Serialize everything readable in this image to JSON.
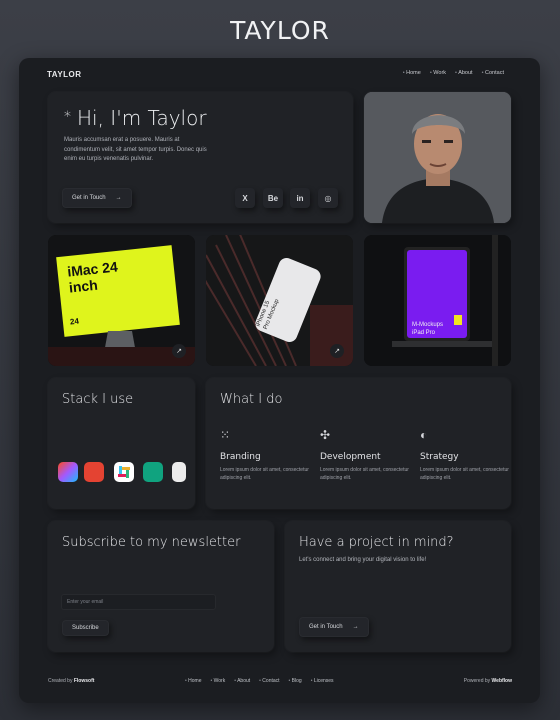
{
  "page_title": "TAYLOR",
  "header": {
    "logo": "TAYLOR",
    "nav": [
      "Home",
      "Work",
      "About",
      "Contact"
    ]
  },
  "hero": {
    "greeting": "Hi, I'm Taylor",
    "star": "*",
    "text": "Mauris accumsan erat a posuere. Mauris at condimentum velit, sit amet tempor turpis. Donec quis enim eu turpis venenatis pulvinar.",
    "cta": "Get in Touch",
    "socials": [
      "X",
      "Be",
      "in",
      "◎"
    ]
  },
  "works": [
    {
      "line1": "iMac 24",
      "line2": "inch",
      "small": "24"
    },
    {
      "line1": "iPhone 15",
      "line2": "Pro Mockup"
    },
    {
      "line1": "M-Mockups",
      "line2": "iPad Pro"
    }
  ],
  "stack": {
    "title": "Stack I use"
  },
  "what_i_do": {
    "title": "What I do",
    "items": [
      {
        "name": "Branding",
        "desc": "Lorem ipsum dolor sit amet, consectetur adipiscing elit."
      },
      {
        "name": "Development",
        "desc": "Lorem ipsum dolor sit amet, consectetur adipiscing elit."
      },
      {
        "name": "Strategy",
        "desc": "Lorem ipsum dolor sit amet, consectetur adipiscing elit."
      }
    ]
  },
  "newsletter": {
    "title": "Subscribe to my newsletter",
    "placeholder": "Enter your email",
    "button": "Subscribe"
  },
  "project": {
    "title": "Have a project in mind?",
    "text": "Let's connect and bring your digital vision to life!",
    "cta": "Get in Touch"
  },
  "footer": {
    "created_prefix": "Created by",
    "created_by": "Flowsoft",
    "nav": [
      "Home",
      "Work",
      "About",
      "Contact",
      "Blog",
      "Licenses"
    ],
    "powered_prefix": "Powered by",
    "powered_by": "Webflow"
  },
  "colors": {
    "frame": "#1b1d21",
    "card": "#202226",
    "accent_lime": "#e4f51a",
    "accent_purple": "#7a1cf0"
  }
}
